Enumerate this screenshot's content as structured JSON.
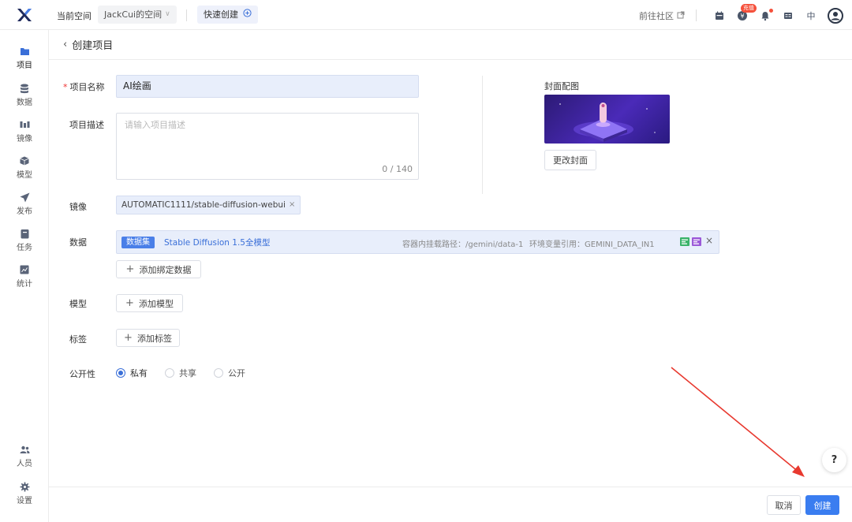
{
  "topbar": {
    "workspace_label": "当前空间",
    "workspace_value": "JackCui的空间",
    "quick_create": "快速创建",
    "community": "前往社区",
    "badge_text": "充值",
    "lang": "中"
  },
  "sidebar": {
    "items": [
      {
        "label": "项目",
        "icon": "folder-icon"
      },
      {
        "label": "数据",
        "icon": "database-icon"
      },
      {
        "label": "镜像",
        "icon": "image-icon"
      },
      {
        "label": "模型",
        "icon": "cube-icon"
      },
      {
        "label": "发布",
        "icon": "send-icon"
      },
      {
        "label": "任务",
        "icon": "task-icon"
      },
      {
        "label": "统计",
        "icon": "chart-icon"
      }
    ],
    "bottom_items": [
      {
        "label": "人员",
        "icon": "people-icon"
      },
      {
        "label": "设置",
        "icon": "gear-icon"
      }
    ]
  },
  "page": {
    "back_title": "创建项目"
  },
  "form": {
    "name_label": "项目名称",
    "name_value": "AI绘画",
    "desc_label": "项目描述",
    "desc_placeholder": "请输入项目描述",
    "desc_count": "0 / 140",
    "cover_label": "封面配图",
    "change_cover": "更改封面",
    "mirror_label": "镜像",
    "mirror_value": "AUTOMATIC1111/stable-diffusion-webui",
    "data_label": "数据",
    "dataset_badge": "数据集",
    "dataset_name": "Stable Diffusion 1.5全模型",
    "dataset_path": "容器内挂载路径：/gemini/data-1",
    "dataset_env": "环境变量引用：GEMINI_DATA_IN1",
    "add_data": "添加绑定数据",
    "model_label": "模型",
    "add_model": "添加模型",
    "tag_label": "标签",
    "add_tag": "添加标签",
    "visibility_label": "公开性",
    "visibility_options": [
      "私有",
      "共享",
      "公开"
    ],
    "visibility_selected": "私有"
  },
  "footer": {
    "cancel": "取消",
    "create": "创建"
  },
  "help": "?",
  "colors": {
    "primary": "#3a7df0",
    "input_bg": "#e8eefb",
    "required": "#e33333",
    "annotation_arrow": "#e8392f"
  }
}
